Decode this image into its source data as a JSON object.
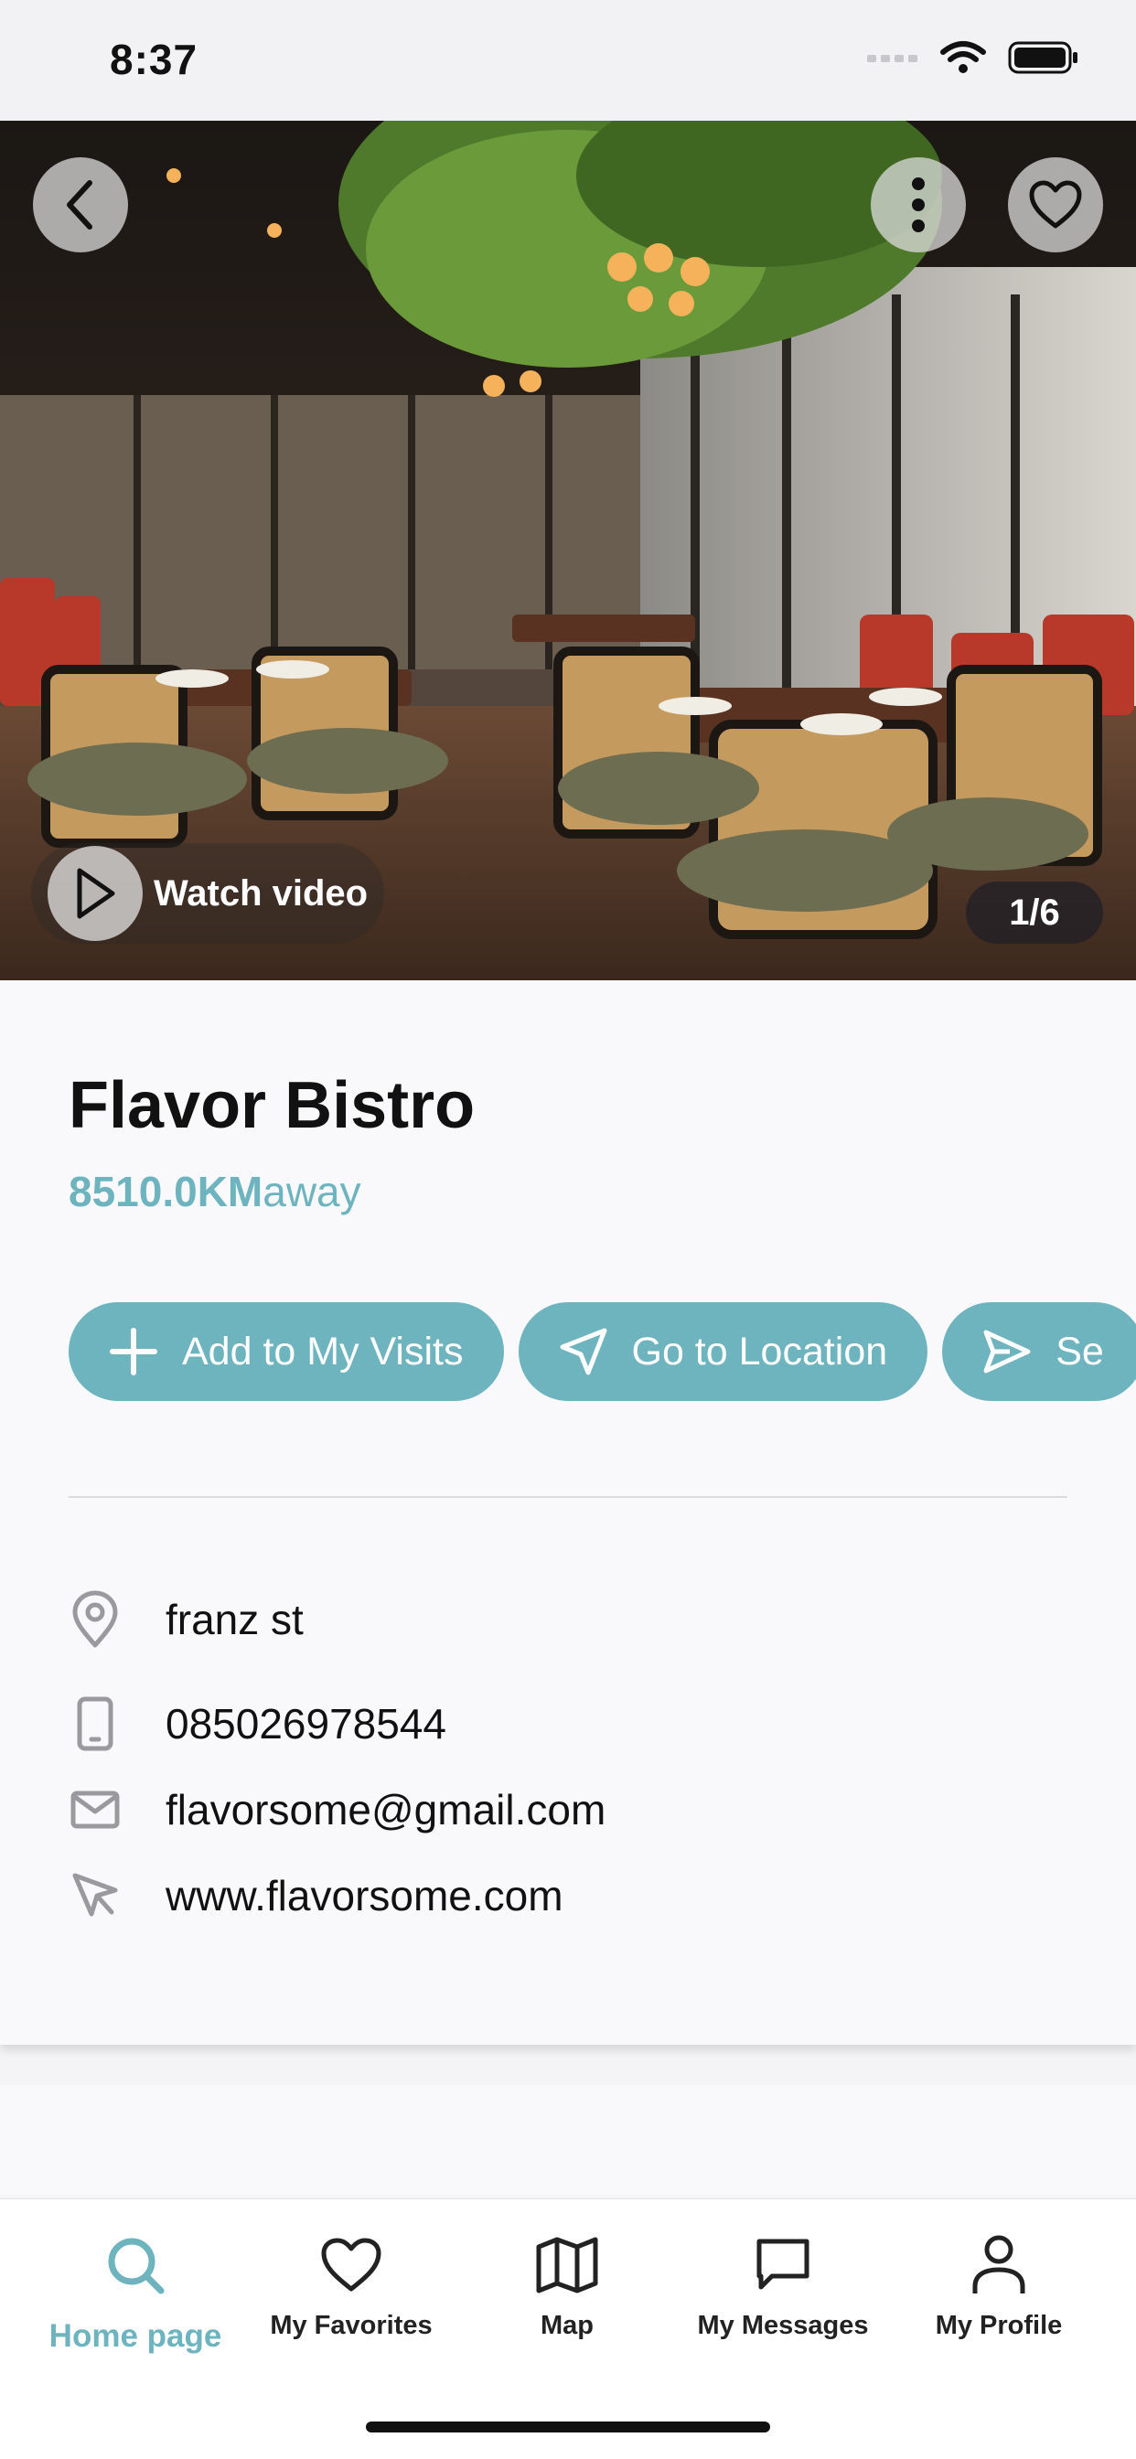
{
  "status_bar": {
    "time": "8:37"
  },
  "hero": {
    "watch_video_label": "Watch video",
    "image_counter": "1/6"
  },
  "restaurant": {
    "name": "Flavor Bistro",
    "distance_value": "8510.0KM",
    "distance_suffix": "away"
  },
  "actions": [
    {
      "label": "Add to My Visits",
      "icon": "plus-icon"
    },
    {
      "label": "Go to Location",
      "icon": "navigation-arrow-icon"
    },
    {
      "label": "Se",
      "icon": "send-icon"
    }
  ],
  "details": {
    "address": "franz st",
    "phone": "085026978544",
    "email": "flavorsome@gmail.com",
    "website": "www.flavorsome.com"
  },
  "tab_bar": {
    "tabs": [
      {
        "label": "Home page",
        "icon": "search-icon",
        "active": true
      },
      {
        "label": "My Favorites",
        "icon": "heart-icon",
        "active": false
      },
      {
        "label": "Map",
        "icon": "map-icon",
        "active": false
      },
      {
        "label": "My Messages",
        "icon": "message-icon",
        "active": false
      },
      {
        "label": "My Profile",
        "icon": "person-icon",
        "active": false
      }
    ]
  },
  "colors": {
    "accent": "#6eb4bf",
    "text": "#111111",
    "background": "#f9f9fb"
  }
}
